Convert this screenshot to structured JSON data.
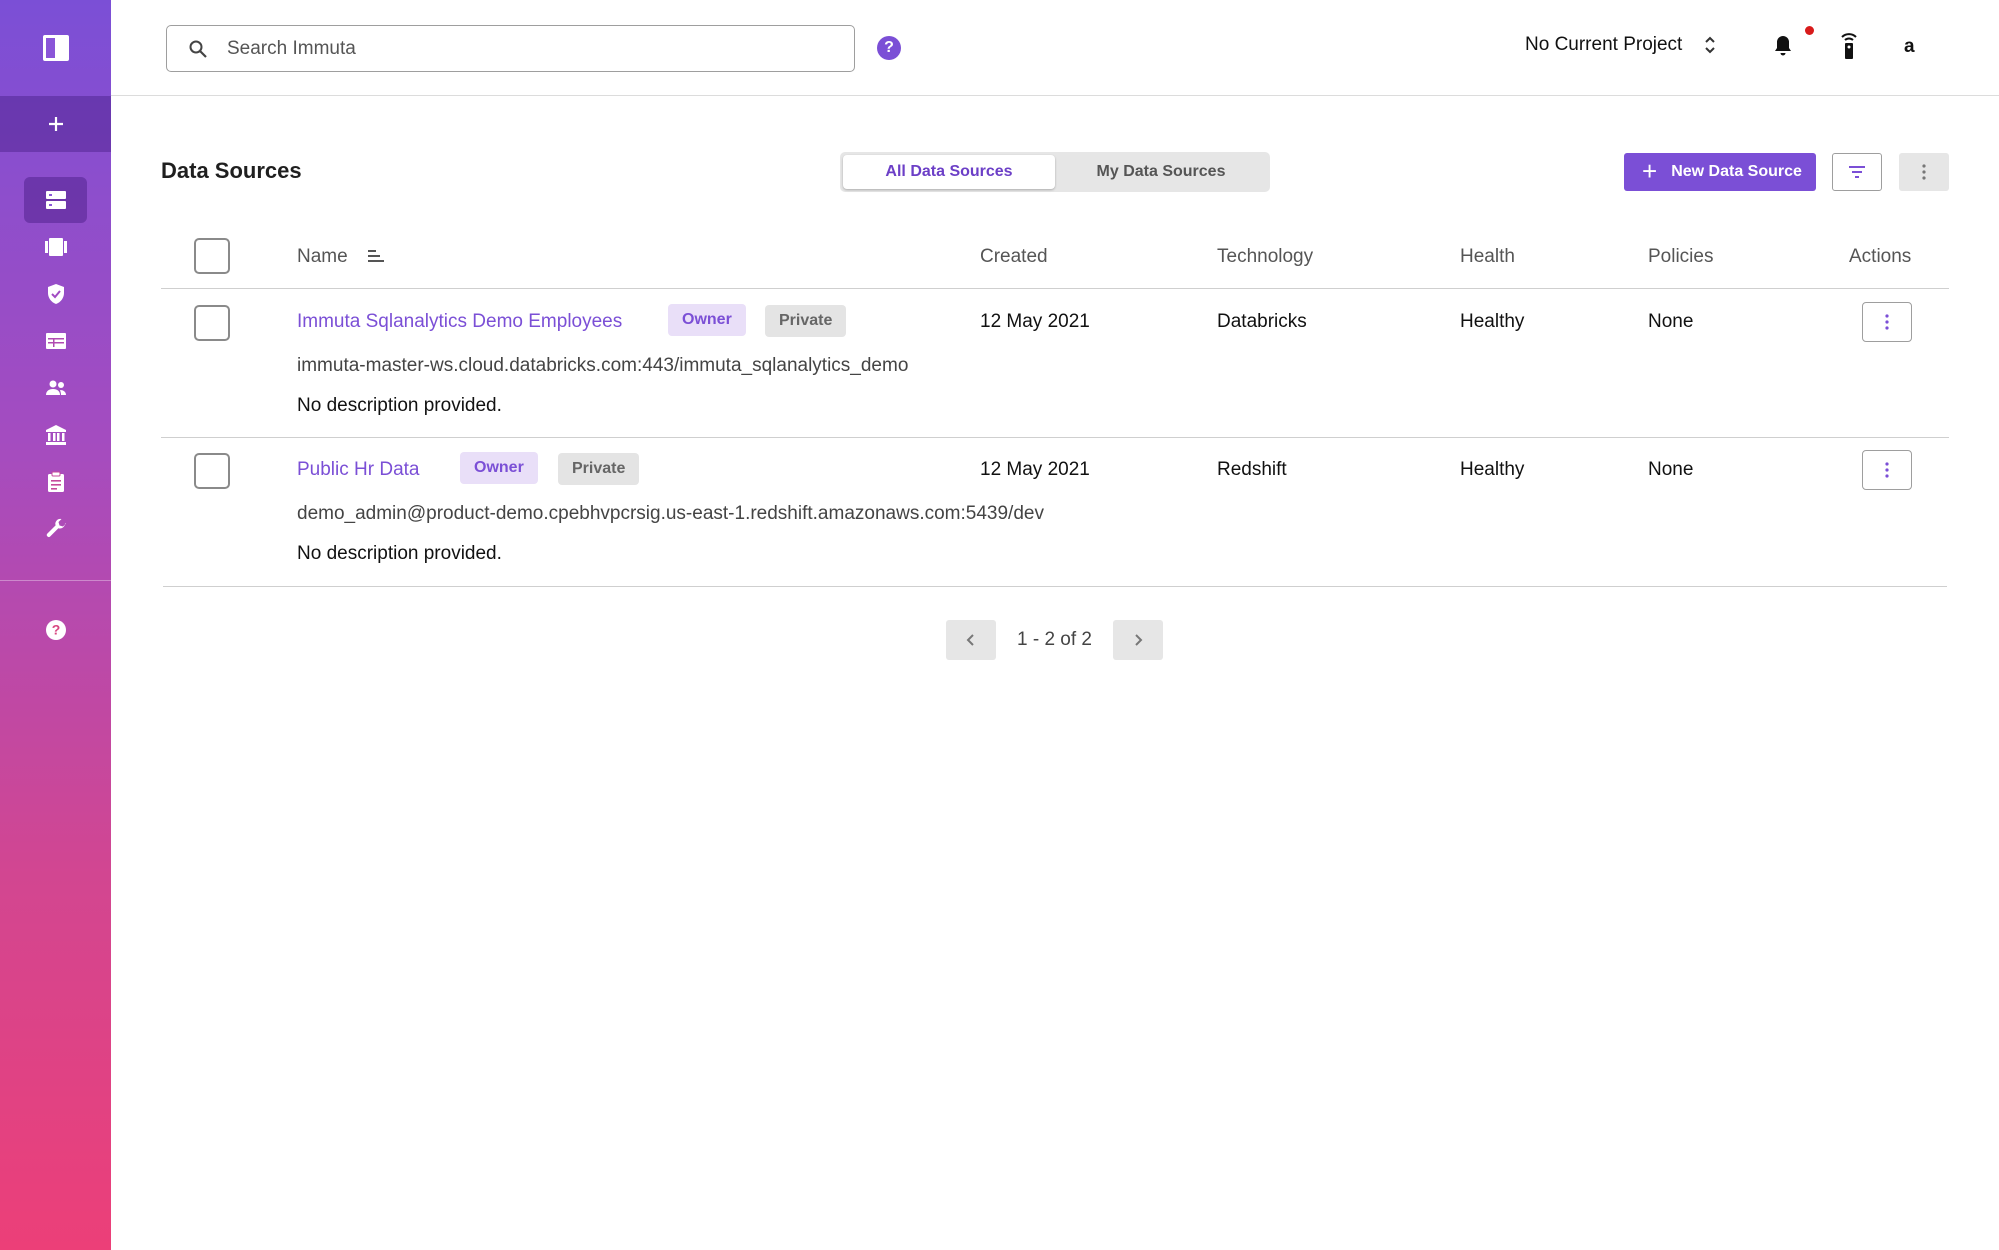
{
  "sidebar": {
    "items": [
      {
        "name": "data-sources",
        "icon": "database-icon",
        "active": true
      },
      {
        "name": "projects",
        "icon": "projects-icon",
        "active": false
      },
      {
        "name": "policies",
        "icon": "shield-icon",
        "active": false
      },
      {
        "name": "query-editor",
        "icon": "table-icon",
        "active": false
      },
      {
        "name": "people",
        "icon": "people-icon",
        "active": false
      },
      {
        "name": "governance",
        "icon": "bank-icon",
        "active": false
      },
      {
        "name": "audit",
        "icon": "clipboard-icon",
        "active": false
      },
      {
        "name": "app-settings",
        "icon": "wrench-icon",
        "active": false
      }
    ],
    "help_icon": "help-icon"
  },
  "topbar": {
    "search_placeholder": "Search Immuta",
    "help_label": "?",
    "project_label": "No Current Project",
    "avatar_label": "a"
  },
  "page": {
    "title": "Data Sources",
    "tabs": [
      {
        "label": "All Data Sources",
        "active": true
      },
      {
        "label": "My Data Sources",
        "active": false
      }
    ],
    "new_button_label": "New Data Source"
  },
  "table": {
    "columns": {
      "name": "Name",
      "created": "Created",
      "technology": "Technology",
      "health": "Health",
      "policies": "Policies",
      "actions": "Actions"
    },
    "rows": [
      {
        "name": "Immuta Sqlanalytics Demo Employees",
        "tags": [
          "Owner",
          "Private"
        ],
        "created": "12 May 2021",
        "technology": "Databricks",
        "health": "Healthy",
        "policies": "None",
        "connection": "immuta-master-ws.cloud.databricks.com:443/immuta_sqlanalytics_demo",
        "description": "No description provided."
      },
      {
        "name": "Public Hr Data",
        "tags": [
          "Owner",
          "Private"
        ],
        "created": "12 May 2021",
        "technology": "Redshift",
        "health": "Healthy",
        "policies": "None",
        "connection": "demo_admin@product-demo.cpebhvpcrsig.us-east-1.redshift.amazonaws.com:5439/dev",
        "description": "No description provided."
      }
    ]
  },
  "pagination": {
    "text": "1 - 2 of 2"
  },
  "colors": {
    "accent": "#7b4fd6",
    "sidebar_top": "#7b4fd6",
    "sidebar_bottom": "#ec3f78",
    "notification": "#d81b1b"
  }
}
